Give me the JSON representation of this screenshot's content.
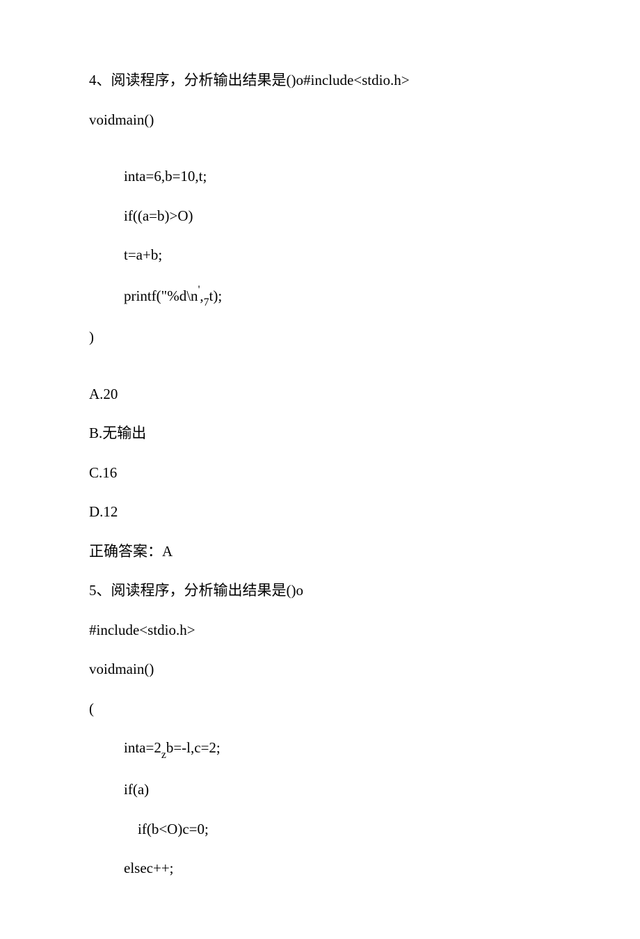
{
  "q4": {
    "prompt_a": "4、阅读程序，分析输出结果是()o#include<stdio.h>",
    "prompt_b": "voidmain()",
    "code1": "inta=6,b=10,t;",
    "code2": "if((a=b)>O)",
    "code3": "t=a+b;",
    "code4_pre": "printf(\"%d\\n",
    "code4_sup": "'",
    "code4_mid": ",",
    "code4_sub": "7",
    "code4_post": "t);",
    "close": ")",
    "optA": "A.20",
    "optB": "B.无输出",
    "optC": "C.16",
    "optD": "D.12",
    "answer": "正确答案：A"
  },
  "q5": {
    "prompt": "5、阅读程序，分析输出结果是()o",
    "inc": "#include<stdio.h>",
    "main": "voidmain()",
    "open": "(",
    "code1_pre": "inta=2",
    "code1_sub": "z",
    "code1_post": "b=-l,c=2;",
    "code2": "if(a)",
    "code3": "if(b<O)c=0;",
    "code4": "elsec++;"
  }
}
